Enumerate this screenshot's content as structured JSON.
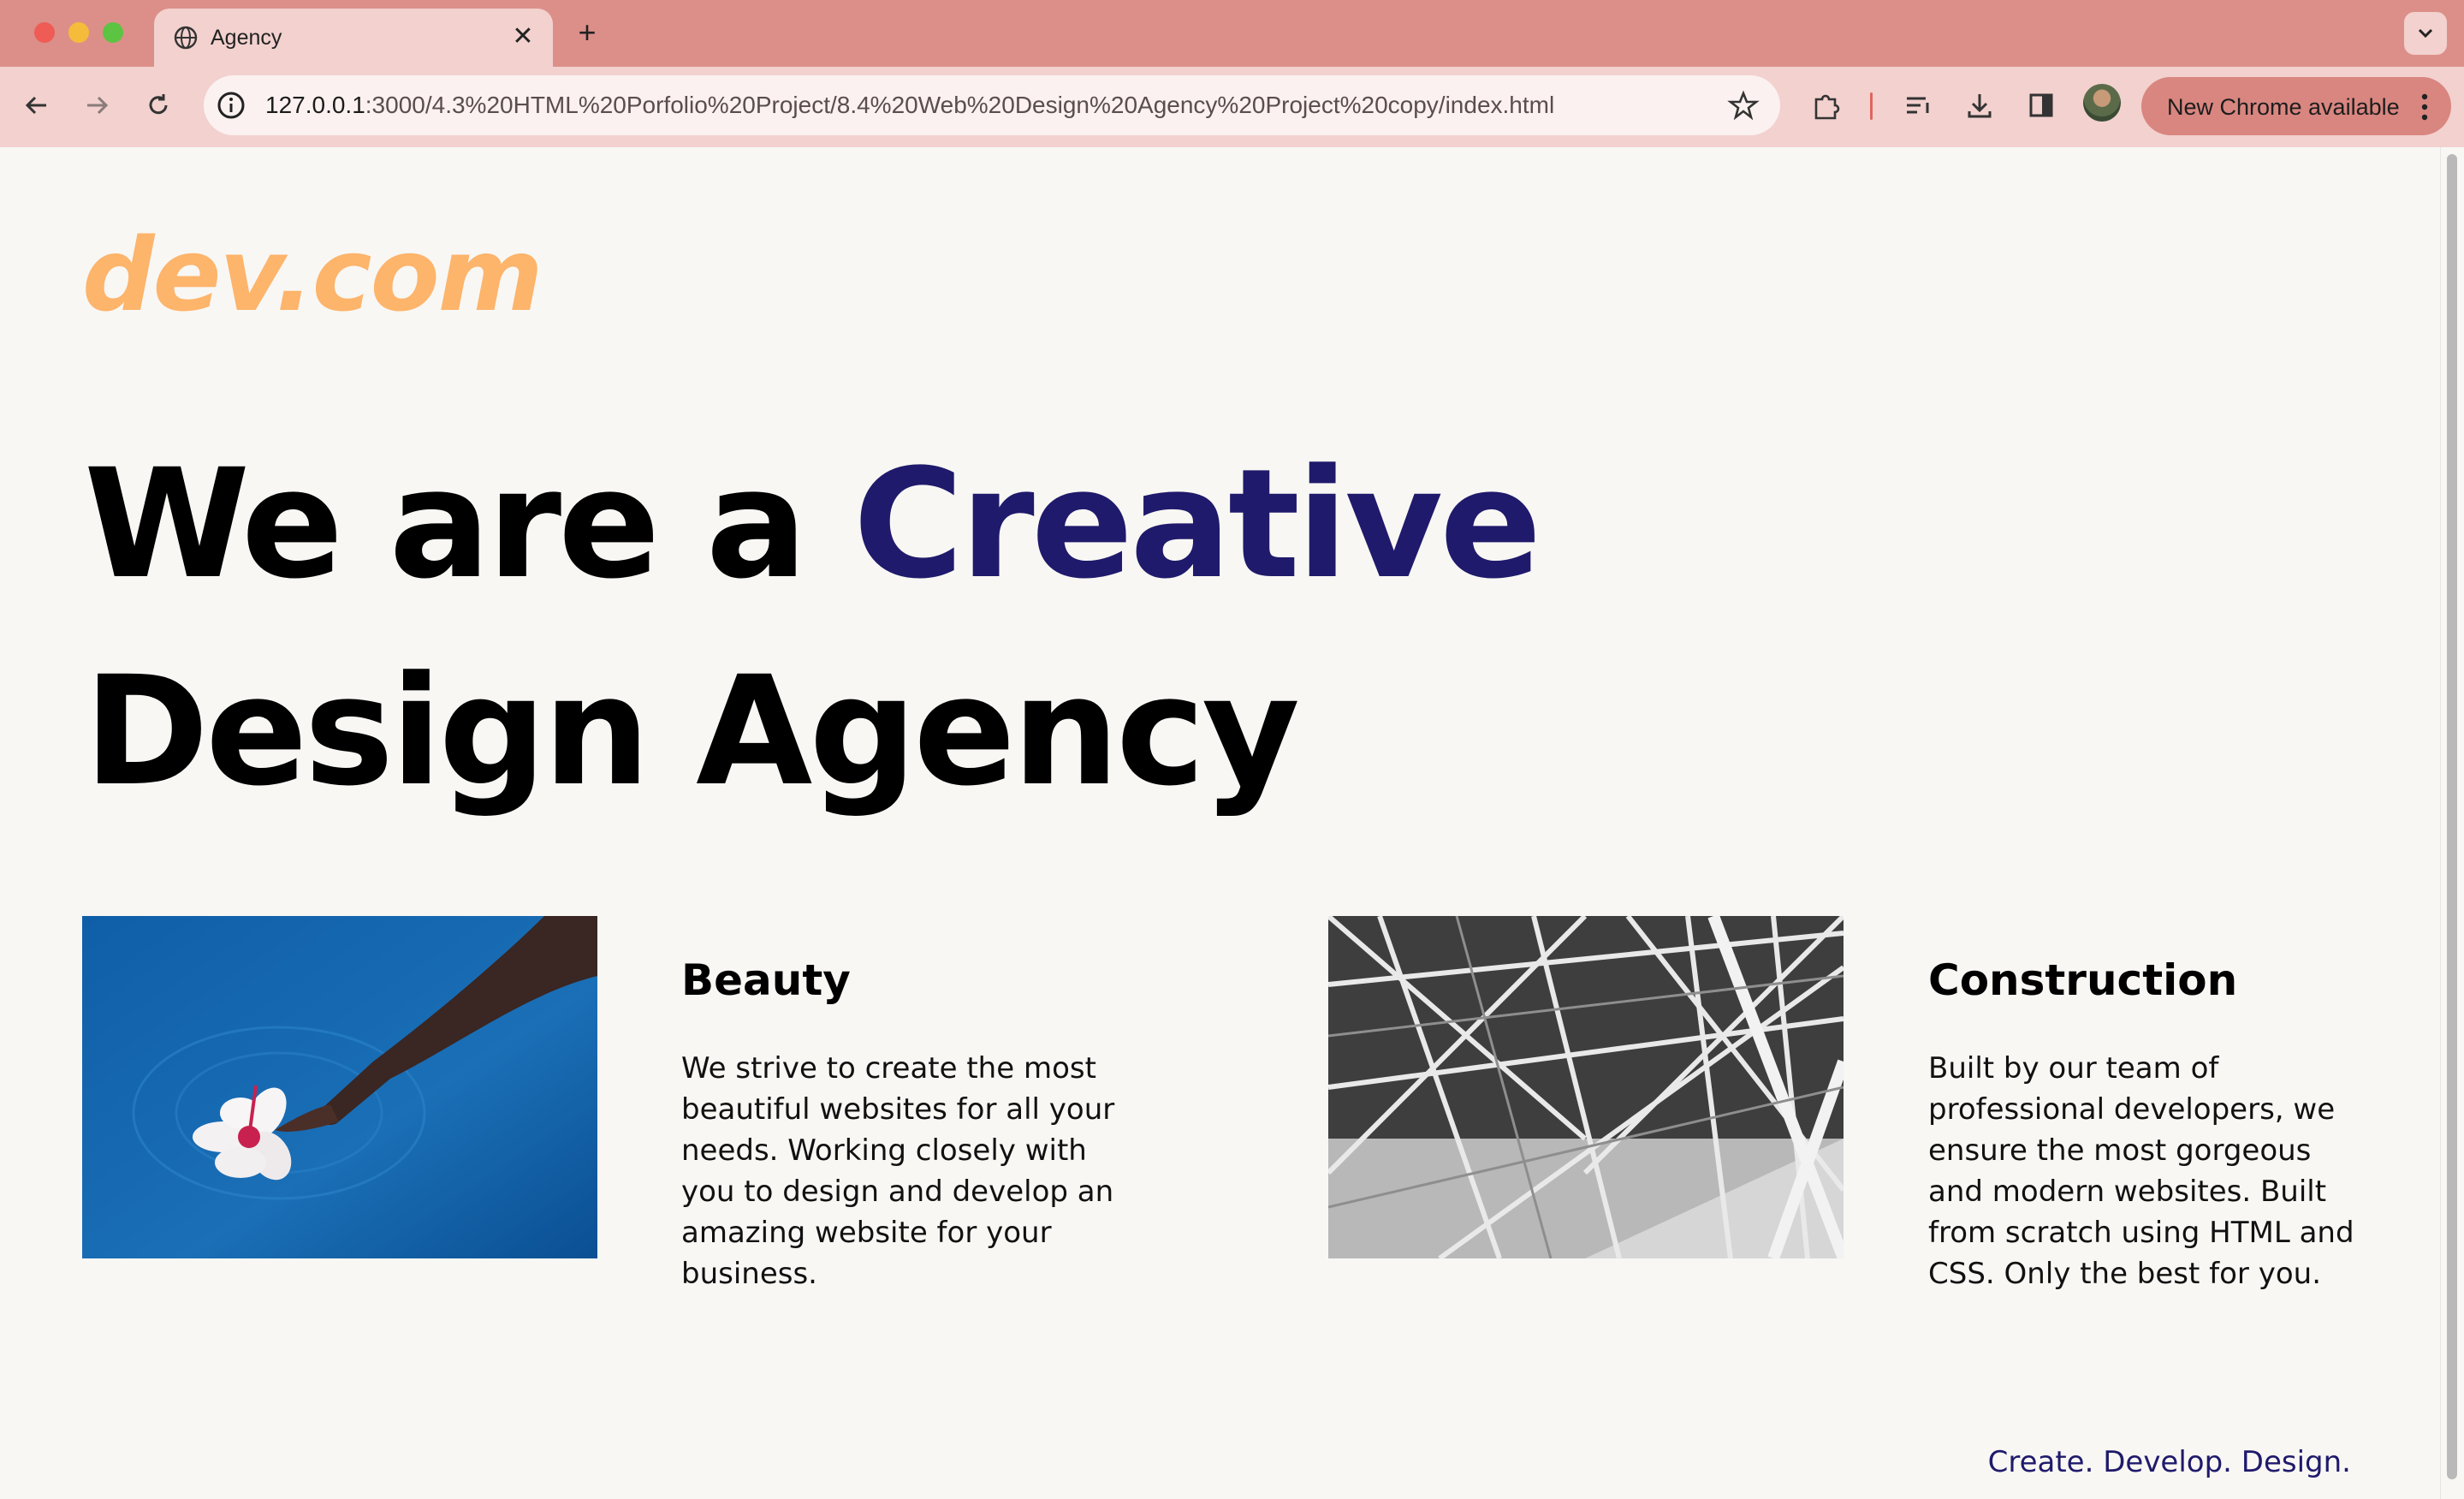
{
  "browser": {
    "tab_title": "Agency",
    "url_host": "127.0.0.1",
    "url_rest": ":3000/4.3%20HTML%20Porfolio%20Project/8.4%20Web%20Design%20Agency%20Project%20copy/index.html",
    "update_label": "New Chrome available",
    "icons": [
      "back-icon",
      "forward-icon",
      "reload-icon",
      "info-icon",
      "star-icon",
      "extensions-icon",
      "reading-list-icon",
      "download-icon",
      "side-panel-icon",
      "profile-avatar",
      "more-icon"
    ]
  },
  "page": {
    "logo": "dev.com",
    "hero_line1": "We are a ",
    "hero_accent": "Creative",
    "hero_line2": "Design Agency",
    "cards": [
      {
        "title": "Beauty",
        "text": "We strive to create the most beautiful websites for all your needs. Working closely with you to design and develop an amazing website for your business."
      },
      {
        "title": "Construction",
        "text": "Built by our team of professional developers, we ensure the most gorgeous and modern websites. Built from scratch using HTML and CSS. Only the best for you."
      }
    ],
    "tagline": "Create. Develop. Design."
  },
  "colors": {
    "chrome_frame": "#dc8f89",
    "chrome_toolbar": "#f2d1ce",
    "logo": "#fdb46b",
    "accent": "#1f1a6b",
    "page_bg": "#f8f7f4"
  }
}
